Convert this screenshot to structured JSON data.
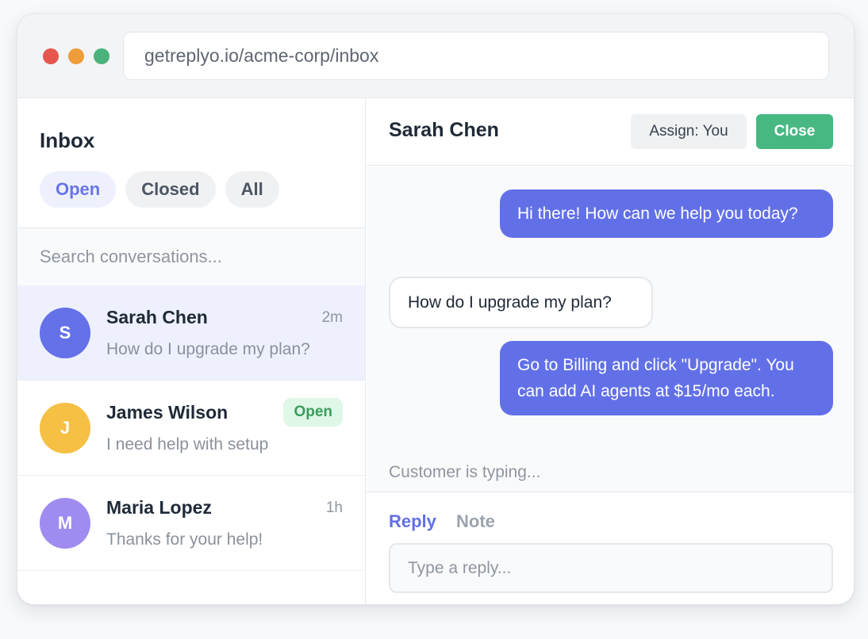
{
  "browser": {
    "url": "getreplyo.io/acme-corp/inbox",
    "colors": {
      "close": "#e5564d",
      "minimize": "#ef9d3a",
      "maximize": "#4ab27a"
    }
  },
  "sidebar": {
    "title": "Inbox",
    "filters": [
      {
        "label": "Open",
        "active": true
      },
      {
        "label": "Closed",
        "active": false
      },
      {
        "label": "All",
        "active": false
      }
    ],
    "search_placeholder": "Search conversations...",
    "conversations": [
      {
        "initial": "S",
        "name": "Sarah Chen",
        "preview": "How do I upgrade my plan?",
        "time": "2m",
        "badge": "",
        "avatar_color": "#6471e8",
        "selected": true
      },
      {
        "initial": "J",
        "name": "James Wilson",
        "preview": "I need help with setup",
        "time": "",
        "badge": "Open",
        "avatar_color": "#f5c043",
        "selected": false
      },
      {
        "initial": "M",
        "name": "Maria Lopez",
        "preview": "Thanks for your help!",
        "time": "1h",
        "badge": "",
        "avatar_color": "#a08cf0",
        "selected": false
      }
    ]
  },
  "chat": {
    "title": "Sarah Chen",
    "assign_label": "Assign: You",
    "close_label": "Close",
    "messages": [
      {
        "from": "agent",
        "text": "Hi there! How can we help you today?"
      },
      {
        "from": "customer",
        "text": "How do I upgrade my plan?"
      },
      {
        "from": "agent",
        "text": "Go to Billing and click \"Upgrade\". You can add AI agents at $15/mo each."
      }
    ],
    "typing_indicator": "Customer is typing...",
    "composer": {
      "tabs": [
        {
          "label": "Reply",
          "active": true
        },
        {
          "label": "Note",
          "active": false
        }
      ],
      "placeholder": "Type a reply..."
    }
  },
  "colors": {
    "accent": "#6270e8",
    "success": "#48b883",
    "badge_bg": "#dff7e7",
    "badge_text": "#3a9d5d"
  }
}
